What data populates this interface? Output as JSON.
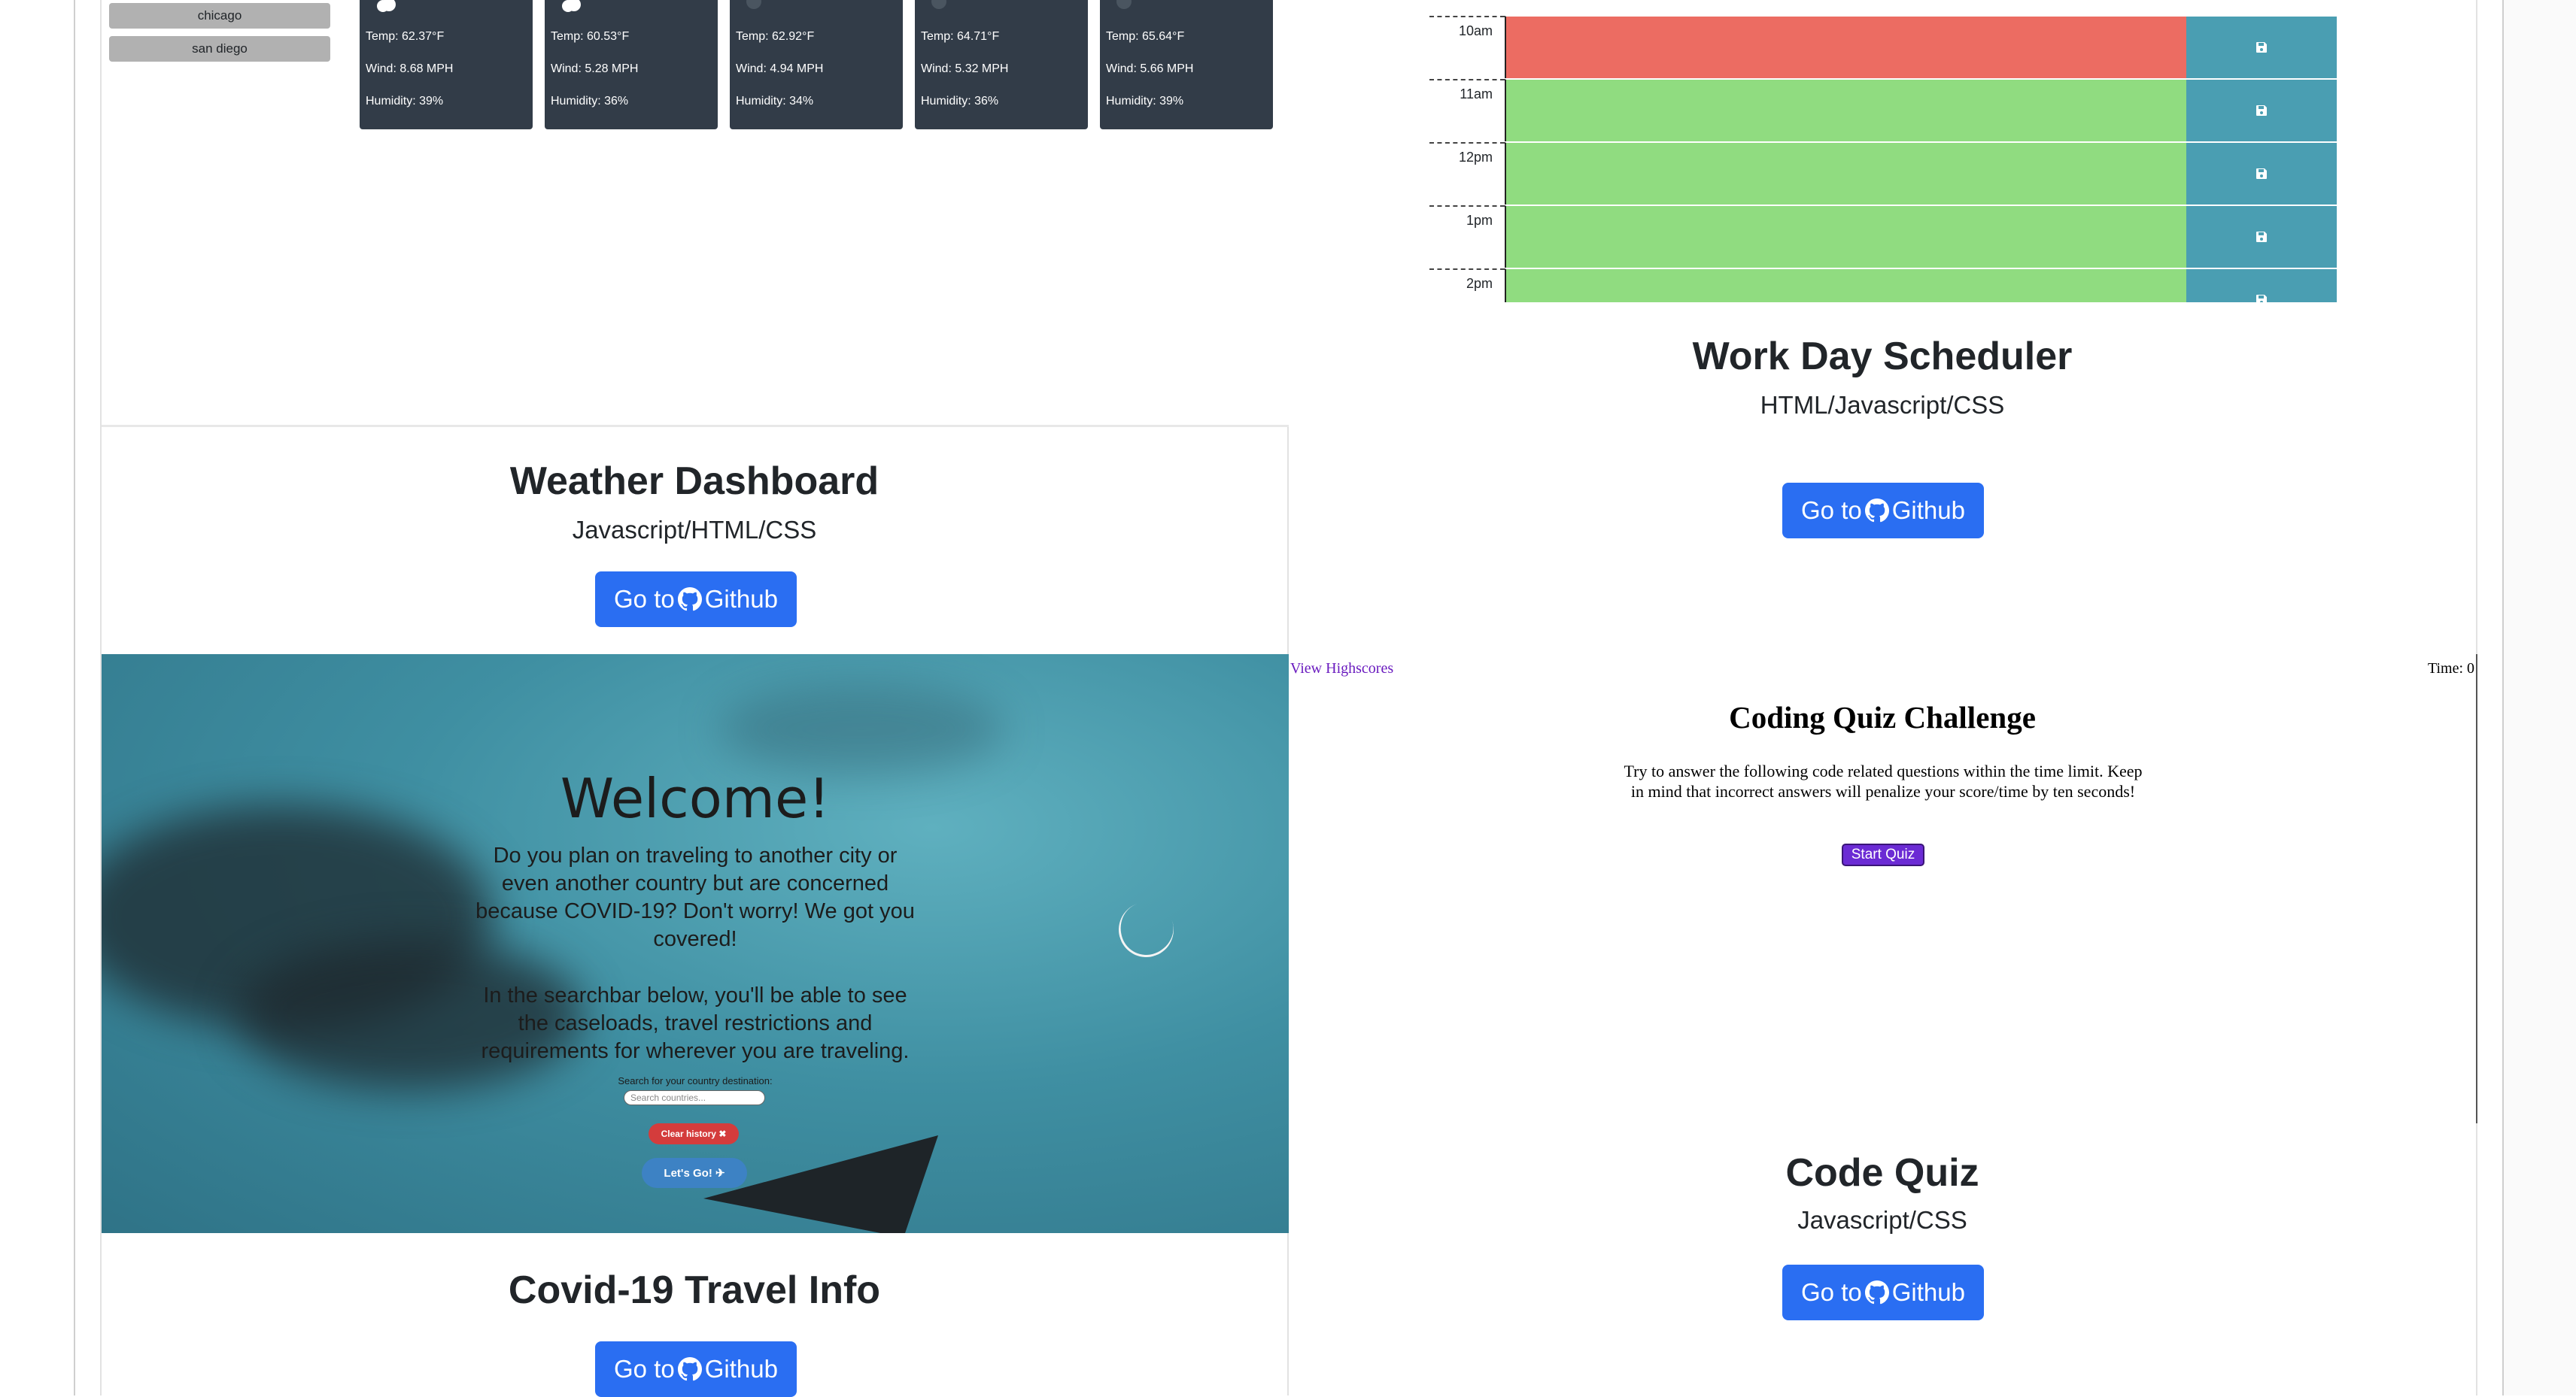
{
  "weather": {
    "cities": [
      "chicago",
      "san diego"
    ],
    "days": [
      {
        "icon": "cloud-icon",
        "temp": "Temp: 62.37°F",
        "wind": "Wind: 8.68 MPH",
        "humidity": "Humidity: 39%"
      },
      {
        "icon": "cloud-icon",
        "temp": "Temp: 60.53°F",
        "wind": "Wind: 5.28 MPH",
        "humidity": "Humidity: 36%"
      },
      {
        "icon": "dark-cloud-icon",
        "temp": "Temp: 62.92°F",
        "wind": "Wind: 4.94 MPH",
        "humidity": "Humidity: 34%"
      },
      {
        "icon": "dark-cloud-icon",
        "temp": "Temp: 64.71°F",
        "wind": "Wind: 5.32 MPH",
        "humidity": "Humidity: 36%"
      },
      {
        "icon": "dark-cloud-icon",
        "temp": "Temp: 65.64°F",
        "wind": "Wind: 5.66 MPH",
        "humidity": "Humidity: 39%"
      }
    ],
    "title": "Weather Dashboard",
    "tech": "Javascript/HTML/CSS",
    "button_prefix": "Go to",
    "button_suffix": "Github"
  },
  "scheduler": {
    "hours": [
      {
        "label": "10am",
        "state": "present",
        "color": "#ec6c62"
      },
      {
        "label": "11am",
        "state": "future",
        "color": "#90dc80"
      },
      {
        "label": "12pm",
        "state": "future",
        "color": "#90dc80"
      },
      {
        "label": "1pm",
        "state": "future",
        "color": "#90dc80"
      },
      {
        "label": "2pm",
        "state": "future",
        "color": "#90dc80"
      }
    ],
    "title": "Work Day Scheduler",
    "tech": "HTML/Javascript/CSS",
    "button_prefix": "Go to",
    "button_suffix": "Github"
  },
  "covid": {
    "heading": "Welcome!",
    "paragraph1": "Do you plan on traveling to another city or even another country but are concerned because COVID-19? Don't worry! We got you covered!",
    "paragraph2": "In the searchbar below, you'll be able to see the caseloads, travel restrictions and requirements for wherever you are traveling.",
    "search_label": "Search for your country destination:",
    "search_placeholder": "Search countries...",
    "clear_label": "Clear history",
    "go_label": "Let's Go!",
    "title": "Covid-19 Travel Info",
    "button_prefix": "Go to",
    "button_suffix": "Github"
  },
  "quiz": {
    "highscores_link": "View Highscores",
    "time": "Time: 0",
    "heading": "Coding Quiz Challenge",
    "instructions": "Try to answer the following code related questions within the time limit. Keep in mind that incorrect answers will penalize your score/time by ten seconds!",
    "start_label": "Start Quiz",
    "title": "Code Quiz",
    "tech": "Javascript/CSS",
    "button_prefix": "Go to",
    "button_suffix": "Github"
  },
  "colors": {
    "button_blue": "#2a6ef2",
    "weather_card": "#323c48",
    "present": "#ec6c62",
    "future": "#90dc80",
    "save": "#4a9eb2"
  }
}
